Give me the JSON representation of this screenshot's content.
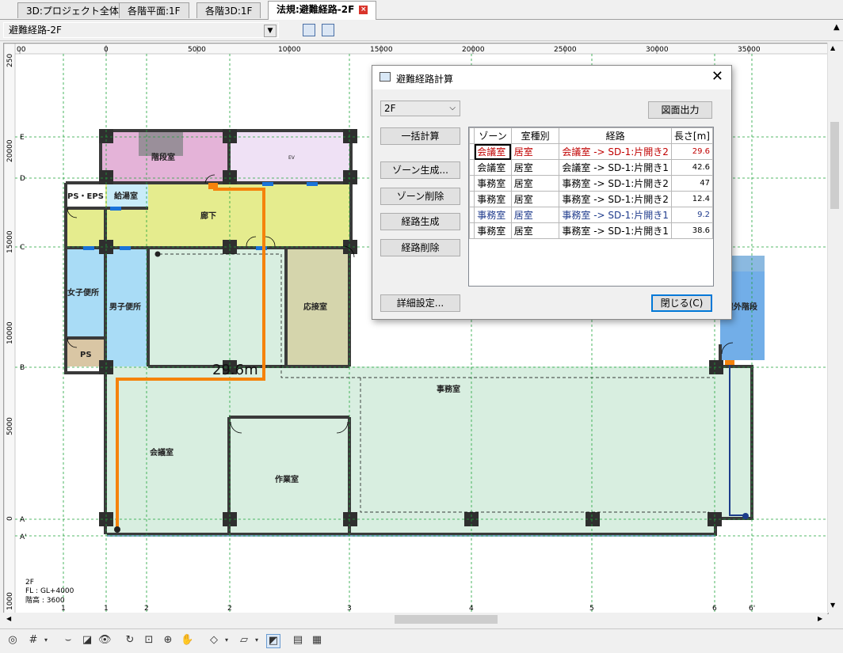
{
  "tabs": [
    {
      "label": "3D:プロジェクト全体",
      "active": false
    },
    {
      "label": "各階平面:1F",
      "active": false
    },
    {
      "label": "各階3D:1F",
      "active": false
    },
    {
      "label": "法規:避難経路-2F",
      "active": true
    }
  ],
  "view_selector": {
    "value": "避難経路-2F"
  },
  "ruler": {
    "top_labels": [
      "00",
      "0",
      "5000",
      "10000",
      "15000",
      "20000",
      "25000",
      "30000",
      "35000"
    ],
    "left_labels": [
      "250",
      "20000",
      "15000",
      "10000",
      "5000",
      "0",
      "1000"
    ]
  },
  "grid_axes": {
    "rows": [
      "E",
      "D",
      "C",
      "B",
      "A",
      "A'"
    ],
    "columns": [
      "1",
      "1",
      "2",
      "2",
      "3",
      "4",
      "5",
      "6",
      "6'"
    ]
  },
  "rooms": {
    "stair": "階段室",
    "ev": "EV",
    "ps_eps": "PS・EPS",
    "kitchen": "給湯室",
    "corridor": "廊下",
    "womens_wc": "女子便所",
    "mens_wc": "男子便所",
    "ps": "PS",
    "reception": "応接室",
    "outdoor_stair": "屋外階段",
    "office": "事務室",
    "meeting": "会議室",
    "workroom": "作業室"
  },
  "route_label": "29.6m",
  "floor_info": {
    "floor": "2F",
    "fl": "FL : GL+4000",
    "height": "階高 : 3600"
  },
  "dialog": {
    "title": "避難経路計算",
    "floor_select": "2F",
    "buttons": {
      "export": "図面出力",
      "batch": "一括計算",
      "zone_create": "ゾーン生成...",
      "zone_delete": "ゾーン削除",
      "route_create": "経路生成",
      "route_delete": "経路削除",
      "detail": "詳細設定...",
      "close": "閉じる(C)"
    },
    "table": {
      "headers": [
        "ゾーン",
        "室種別",
        "経路",
        "長さ[m]"
      ],
      "rows": [
        {
          "zone": "会議室",
          "type": "居室",
          "route": "会議室 -> SD-1:片開き2",
          "length": "29.6",
          "color": "red"
        },
        {
          "zone": "会議室",
          "type": "居室",
          "route": "会議室 -> SD-1:片開き1",
          "length": "42.6",
          "color": "black"
        },
        {
          "zone": "事務室",
          "type": "居室",
          "route": "事務室 -> SD-1:片開き2",
          "length": "47",
          "color": "black"
        },
        {
          "zone": "事務室",
          "type": "居室",
          "route": "事務室 -> SD-1:片開き2",
          "length": "12.4",
          "color": "black"
        },
        {
          "zone": "事務室",
          "type": "居室",
          "route": "事務室 -> SD-1:片開き1",
          "length": "9.2",
          "color": "blue"
        },
        {
          "zone": "事務室",
          "type": "居室",
          "route": "事務室 -> SD-1:片開き1",
          "length": "38.6",
          "color": "black"
        }
      ]
    }
  },
  "colors": {
    "route_orange": "#f5820b",
    "route_blue": "#1c3c8a",
    "grid_green": "#1ea23a",
    "wall": "#3a3a3a"
  }
}
